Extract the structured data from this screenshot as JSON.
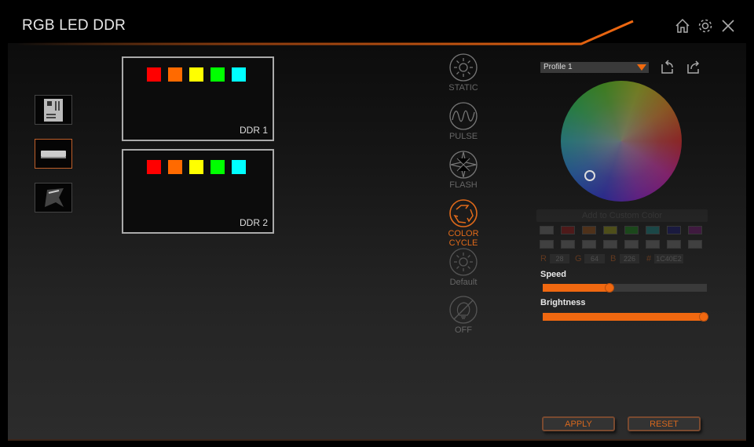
{
  "app": {
    "title": "RGB LED DDR"
  },
  "top_icons": [
    {
      "name": "home-icon"
    },
    {
      "name": "gear-icon"
    },
    {
      "name": "close-icon"
    }
  ],
  "device_tabs": [
    {
      "name": "motherboard",
      "icon": "motherboard-icon",
      "active": false
    },
    {
      "name": "ddr-memory",
      "icon": "memory-stick-icon",
      "active": true
    },
    {
      "name": "graphics-card",
      "icon": "gpu-icon",
      "active": false
    }
  ],
  "ddr_modules": [
    {
      "label": "DDR 1",
      "leds": [
        "#ff0000",
        "#ff6a00",
        "#ffff00",
        "#00ff00",
        "#00ffff"
      ]
    },
    {
      "label": "DDR 2",
      "leds": [
        "#ff0000",
        "#ff6a00",
        "#ffff00",
        "#00ff00",
        "#00ffff"
      ]
    }
  ],
  "modes": [
    {
      "id": "static",
      "label": "STATIC",
      "icon": "sun-icon",
      "active": false
    },
    {
      "id": "pulse",
      "label": "PULSE",
      "icon": "wave-icon",
      "active": false
    },
    {
      "id": "flash",
      "label": "FLASH",
      "icon": "star-flash-icon",
      "active": false
    },
    {
      "id": "color-cycle",
      "label": "COLOR CYCLE",
      "icon": "cycle-arrows-icon",
      "active": true
    },
    {
      "id": "default",
      "label": "Default",
      "icon": "sun-icon",
      "active": false
    },
    {
      "id": "off",
      "label": "OFF",
      "icon": "bulb-off-icon",
      "active": false
    }
  ],
  "profile": {
    "selected": "Profile 1"
  },
  "profile_actions": [
    {
      "name": "import-profile-icon"
    },
    {
      "name": "export-profile-icon"
    }
  ],
  "color_picker": {
    "add_custom_label": "Add to Custom Color",
    "preset_colors": [
      "#6a6a6a",
      "#8a1818",
      "#8a4a18",
      "#8a8a18",
      "#1a7a1a",
      "#1a7a7a",
      "#18186a",
      "#6a186a"
    ],
    "custom_colors": [
      "#6a6a6a",
      "#6a6a6a",
      "#6a6a6a",
      "#6a6a6a",
      "#6a6a6a",
      "#6a6a6a",
      "#6a6a6a",
      "#6a6a6a"
    ],
    "r_label": "R",
    "r": "28",
    "g_label": "G",
    "g": "64",
    "b_label": "B",
    "b": "226",
    "hex_label": "#",
    "hex": "1C40E2"
  },
  "speed": {
    "label": "Speed",
    "value_percent": 40
  },
  "brightness": {
    "label": "Brightness",
    "value_percent": 100
  },
  "buttons": {
    "apply": "APPLY",
    "reset": "RESET"
  },
  "colors": {
    "accent": "#f06810"
  }
}
